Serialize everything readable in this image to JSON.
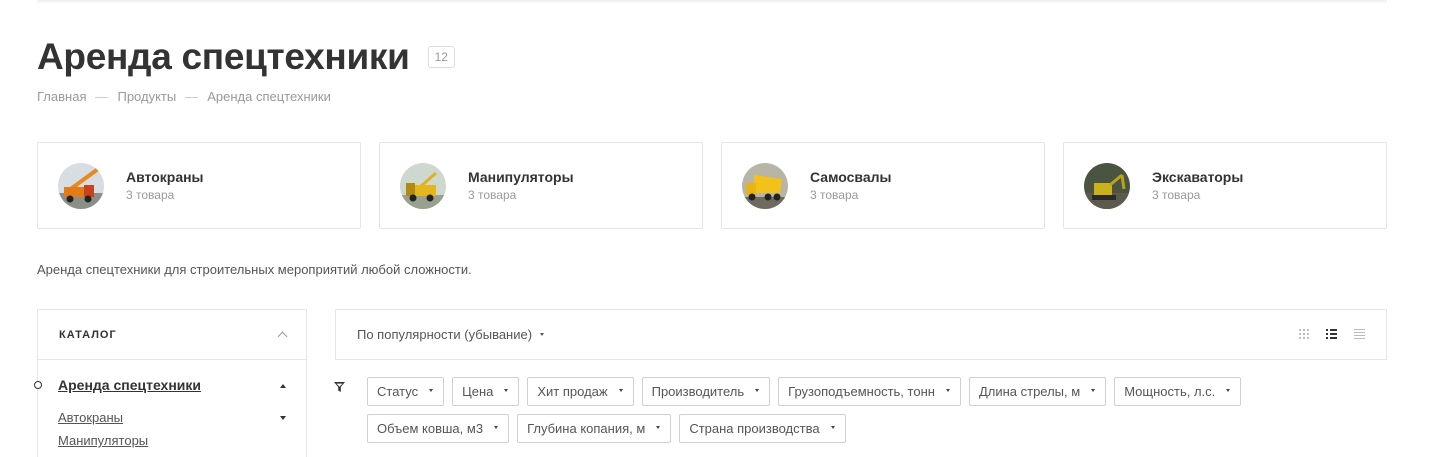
{
  "page": {
    "title": "Аренда спецтехники",
    "count_badge": "12",
    "description": "Аренда спецтехники для строительных мероприятий любой сложности."
  },
  "breadcrumb": [
    "Главная",
    "Продукты",
    "Аренда спецтехники"
  ],
  "categories": [
    {
      "name": "Автокраны",
      "count": "3 товара"
    },
    {
      "name": "Манипуляторы",
      "count": "3 товара"
    },
    {
      "name": "Самосвалы",
      "count": "3 товара"
    },
    {
      "name": "Экскаваторы",
      "count": "3 товара"
    }
  ],
  "sidebar": {
    "title": "КАТАЛОГ",
    "current": "Аренда спецтехники",
    "items": [
      "Автокраны",
      "Манипуляторы"
    ]
  },
  "sort": {
    "label": "По популярности (убывание)"
  },
  "filters": [
    "Статус",
    "Цена",
    "Хит продаж",
    "Производитель",
    "Грузоподъемность, тонн",
    "Длина стрелы, м",
    "Мощность, л.с.",
    "Объем ковша, м3",
    "Глубина копания, м",
    "Страна производства"
  ],
  "colors": {
    "text": "#333333",
    "muted": "#999999",
    "border": "#e5e5e5"
  }
}
